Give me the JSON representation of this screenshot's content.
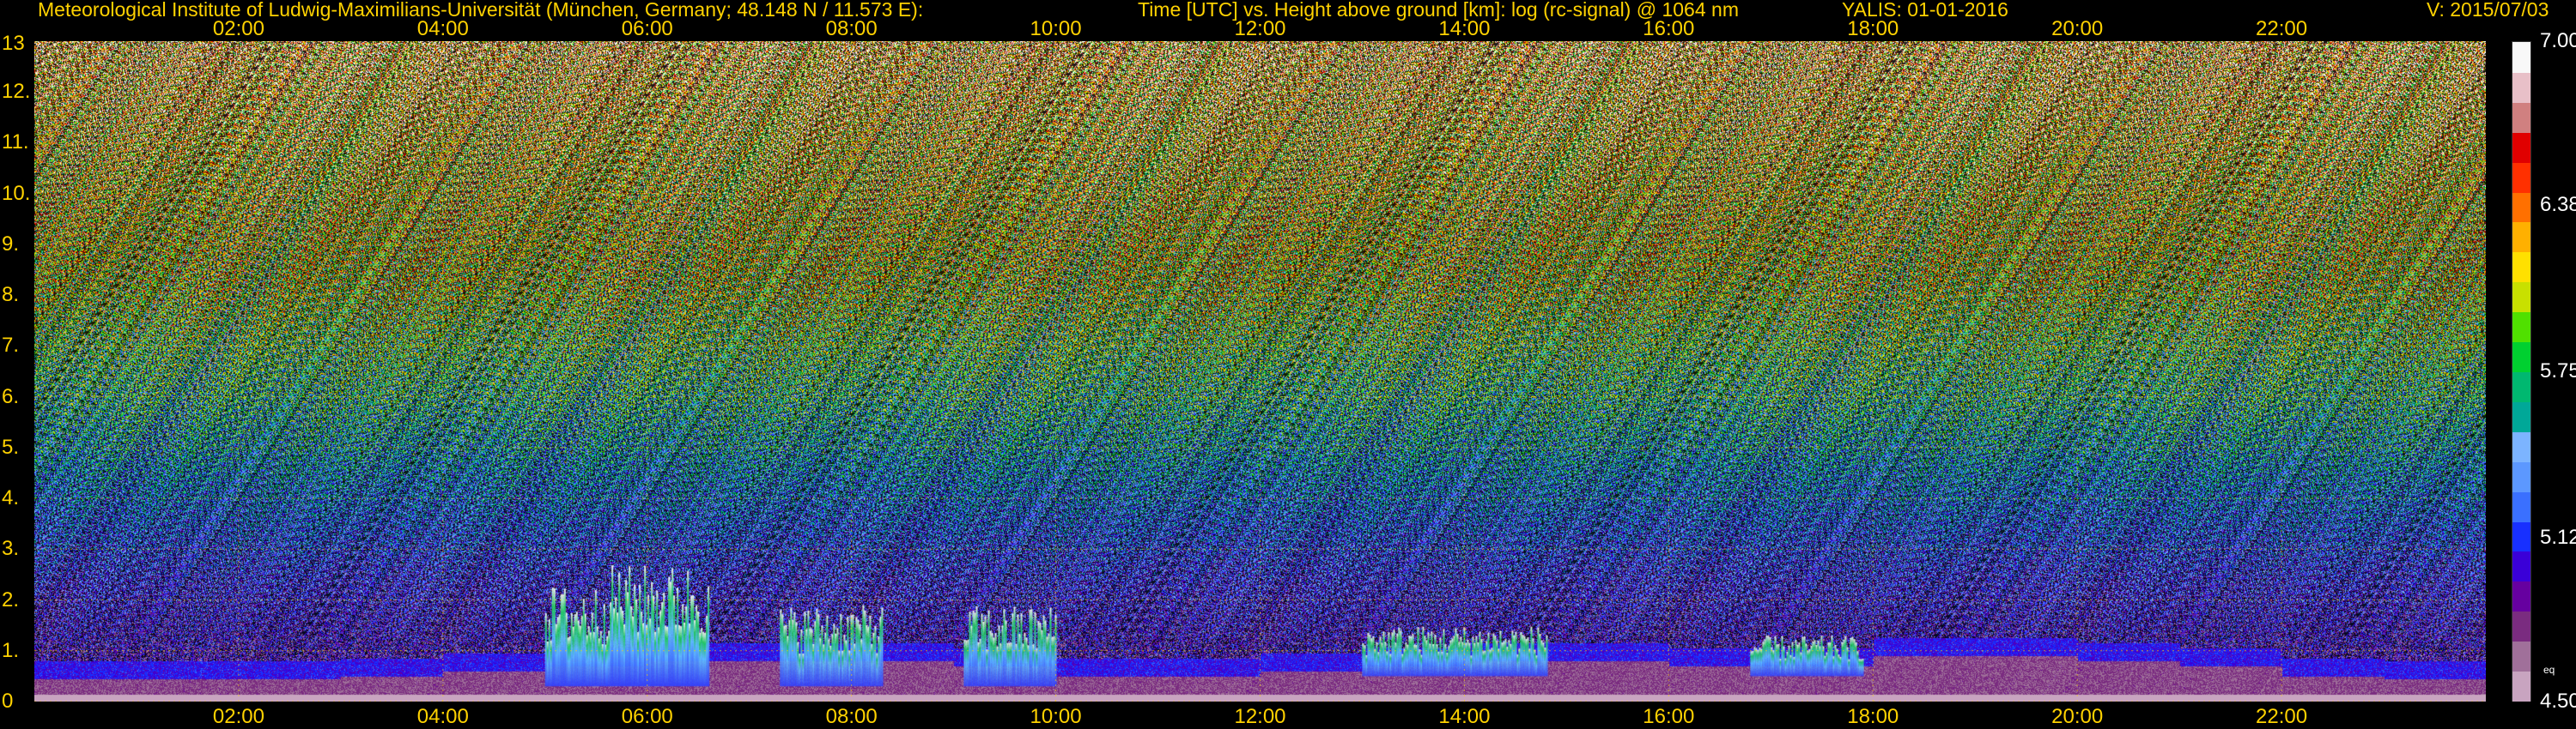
{
  "header": {
    "institute": "Meteorological Institute of Ludwig-Maximilians-Universität (München, Germany; 48.148 N / 11.573 E):",
    "axes_desc": "Time [UTC] vs. Height above ground [km]: log (rc-signal) @ 1064 nm",
    "instrument": "YALIS: 01-01-2016",
    "version": "V: 2015/07/03"
  },
  "chart_data": {
    "type": "heatmap",
    "title": "Time [UTC] vs. Height above ground [km]: log (rc-signal) @ 1064 nm",
    "xlabel": "Time [UTC]",
    "ylabel": "Height above ground [km]",
    "x_ticks": [
      "02:00",
      "04:00",
      "06:00",
      "08:00",
      "10:00",
      "12:00",
      "14:00",
      "16:00",
      "18:00",
      "20:00",
      "22:00"
    ],
    "x_tick_hours": [
      2,
      4,
      6,
      8,
      10,
      12,
      14,
      16,
      18,
      20,
      22
    ],
    "xlim_hours": [
      0,
      24
    ],
    "y_ticks": [
      "0",
      "1.",
      "2.",
      "3.",
      "4.",
      "5.",
      "6.",
      "7.",
      "8.",
      "9.",
      "10.",
      "11.",
      "12.",
      "13"
    ],
    "y_tick_values": [
      0,
      1,
      2,
      3,
      4,
      5,
      6,
      7,
      8,
      9,
      10,
      11,
      12,
      13
    ],
    "ylim_km": [
      0,
      13
    ],
    "grid": true,
    "colorbar": {
      "labels": [
        "7.00",
        "6.38",
        "5.75",
        "5.12",
        "eq",
        "4.50"
      ],
      "label_values": [
        7.0,
        6.38,
        5.75,
        5.12,
        4.62,
        4.5
      ],
      "range": [
        4.5,
        7.0
      ],
      "colors": [
        "#c8a4c0",
        "#a0709a",
        "#7a2c80",
        "#6600a0",
        "#3a00d8",
        "#1830ff",
        "#3a70ff",
        "#5c98ff",
        "#7cb4ff",
        "#00a898",
        "#00b870",
        "#00d030",
        "#50e000",
        "#c8e000",
        "#ffe000",
        "#ffb000",
        "#ff7000",
        "#ff3000",
        "#e00000",
        "#d08080",
        "#e8c0c8",
        "#f8f8f8"
      ]
    },
    "aerosol_layer_top_km": [
      0.45,
      0.45,
      0.45,
      0.5,
      0.6,
      0.7,
      0.8,
      0.8,
      0.8,
      0.7,
      0.5,
      0.5,
      0.6,
      0.7,
      0.8,
      0.8,
      0.7,
      0.7,
      0.9,
      0.9,
      0.8,
      0.7,
      0.5,
      0.45
    ],
    "cloud_events": [
      {
        "start_h": 5.0,
        "end_h": 5.6,
        "base_km": 0.3,
        "top_km": 2.3
      },
      {
        "start_h": 5.6,
        "end_h": 6.6,
        "base_km": 0.3,
        "top_km": 2.7
      },
      {
        "start_h": 7.3,
        "end_h": 8.3,
        "base_km": 0.3,
        "top_km": 1.9
      },
      {
        "start_h": 9.1,
        "end_h": 10.0,
        "base_km": 0.3,
        "top_km": 1.9
      },
      {
        "start_h": 13.0,
        "end_h": 14.8,
        "base_km": 0.5,
        "top_km": 1.5
      },
      {
        "start_h": 16.8,
        "end_h": 17.9,
        "base_km": 0.5,
        "top_km": 1.3
      }
    ]
  }
}
